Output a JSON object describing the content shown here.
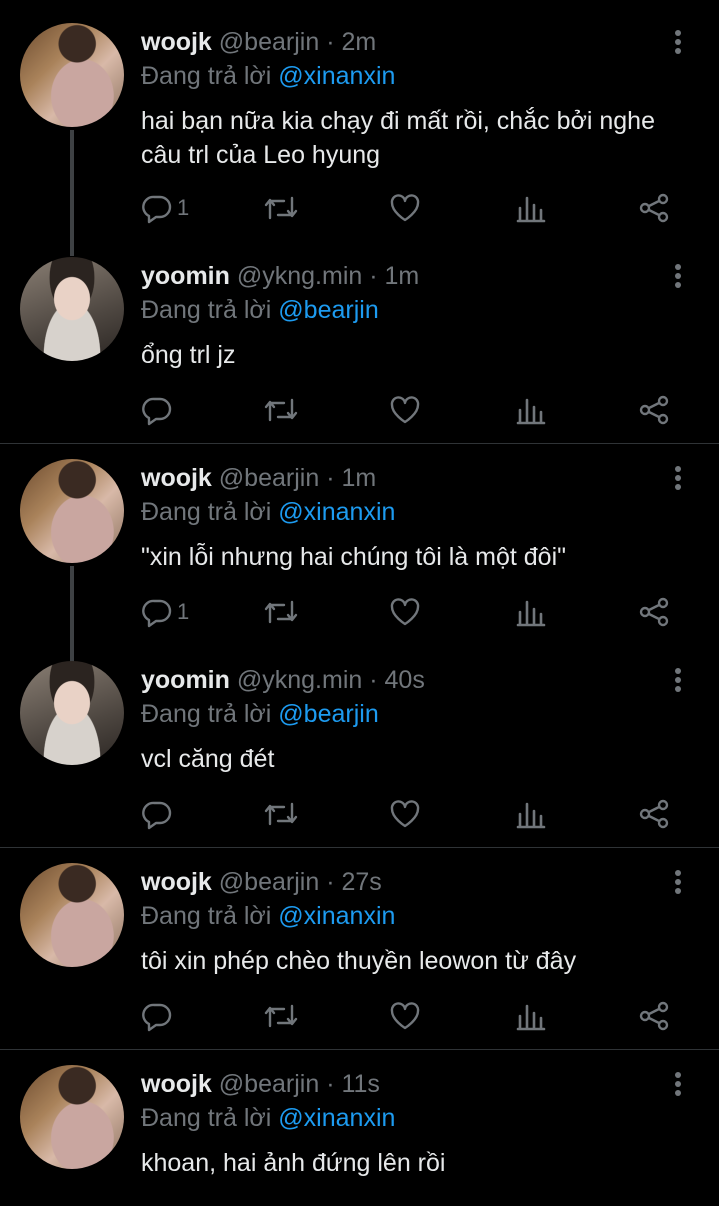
{
  "tweets": [
    {
      "name": "woojk",
      "handle": "@bearjin",
      "dot": "·",
      "time": "2m",
      "reply_prefix": "Đang trả lời",
      "reply_to": "@xinanxin",
      "text": "hai bạn nữa kia chạy đi mất rồi, chắc bởi nghe câu trl của Leo hyung",
      "reply_count": "1",
      "avatar": "woojk"
    },
    {
      "name": "yoomin",
      "handle": "@ykng.min",
      "dot": "·",
      "time": "1m",
      "reply_prefix": "Đang trả lời",
      "reply_to": "@bearjin",
      "text": "ổng trl jz",
      "reply_count": "",
      "avatar": "yoomin"
    },
    {
      "name": "woojk",
      "handle": "@bearjin",
      "dot": "·",
      "time": "1m",
      "reply_prefix": "Đang trả lời",
      "reply_to": "@xinanxin",
      "text": "\"xin lỗi nhưng hai chúng tôi là một đôi\"",
      "reply_count": "1",
      "avatar": "woojk"
    },
    {
      "name": "yoomin",
      "handle": "@ykng.min",
      "dot": "·",
      "time": "40s",
      "reply_prefix": "Đang trả lời",
      "reply_to": "@bearjin",
      "text": "vcl căng đét",
      "reply_count": "",
      "avatar": "yoomin"
    },
    {
      "name": "woojk",
      "handle": "@bearjin",
      "dot": "·",
      "time": "27s",
      "reply_prefix": "Đang trả lời",
      "reply_to": "@xinanxin",
      "text": "tôi xin phép chèo thuyền leowon từ đây",
      "reply_count": "",
      "avatar": "woojk"
    },
    {
      "name": "woojk",
      "handle": "@bearjin",
      "dot": "·",
      "time": "11s",
      "reply_prefix": "Đang trả lời",
      "reply_to": "@xinanxin",
      "text": "khoan, hai ảnh đứng lên rồi",
      "reply_count": "",
      "avatar": "woojk"
    }
  ],
  "icons": {
    "reply": "reply-icon",
    "retweet": "retweet-icon",
    "like": "heart-icon",
    "views": "views-icon",
    "share": "share-icon",
    "more": "more-vertical-icon"
  },
  "colors": {
    "background": "#000000",
    "text": "#e7e9ea",
    "muted": "#71767b",
    "link": "#1d9bf0",
    "divider": "#2f3336"
  }
}
